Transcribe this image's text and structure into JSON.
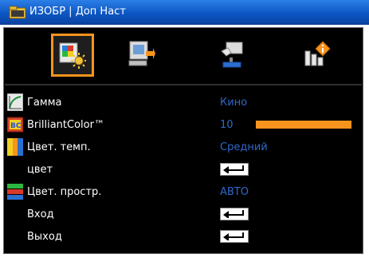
{
  "title": "ИЗОБР | Доп Наст",
  "title_icon": "folder-icon",
  "accent_color": "#f7941d",
  "value_color": "#2f68c9",
  "tabs": [
    {
      "name": "image-tab",
      "icon": "image-settings-icon",
      "selected": true
    },
    {
      "name": "display-tab",
      "icon": "projector-screen-icon",
      "selected": false
    },
    {
      "name": "setup-tab",
      "icon": "hand-setup-icon",
      "selected": false
    },
    {
      "name": "options-tab",
      "icon": "info-options-icon",
      "selected": false
    }
  ],
  "rows": [
    {
      "label": "Гамма",
      "icon": "gamma-icon",
      "value": "Кино"
    },
    {
      "label": "BrilliantColor™",
      "icon": "brilliantcolor-icon",
      "value": "10",
      "level_percent": 100
    },
    {
      "label": "Цвет. темп.",
      "icon": "color-temperature-icon",
      "value": "Средний"
    },
    {
      "label": "цвет",
      "icon": "",
      "enter_icon": "enter-arrow-icon"
    },
    {
      "label": "Цвет. простр.",
      "icon": "color-space-icon",
      "value": "АВТО"
    },
    {
      "label": "Вход",
      "icon": "",
      "enter_icon": "enter-arrow-icon"
    },
    {
      "label": "Выход",
      "icon": "",
      "enter_icon": "enter-arrow-icon"
    }
  ]
}
